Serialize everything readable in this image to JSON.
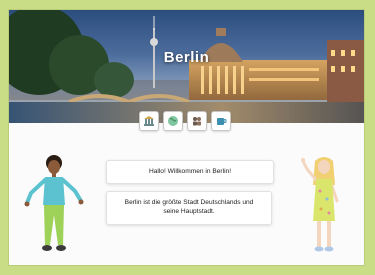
{
  "hero": {
    "title": "Berlin"
  },
  "badges": [
    {
      "icon": "landmark-icon",
      "color": "#6c8a8e"
    },
    {
      "icon": "globe-icon",
      "color": "#4c9a6a"
    },
    {
      "icon": "group-icon",
      "color": "#6b5a4e"
    },
    {
      "icon": "cup-icon",
      "color": "#3c8fb0"
    }
  ],
  "dialog": {
    "greeting": "Hallo! Willkommen in Berlin!",
    "info": "Berlin ist die größte Stadt Deutschlands und seine Hauptstadt."
  },
  "colors": {
    "page_border": "#c9dc86",
    "boy_shirt": "#5cc2cf",
    "boy_pants": "#9ed157",
    "girl_dress": "#d9e66b",
    "girl_hair": "#f0d070"
  }
}
